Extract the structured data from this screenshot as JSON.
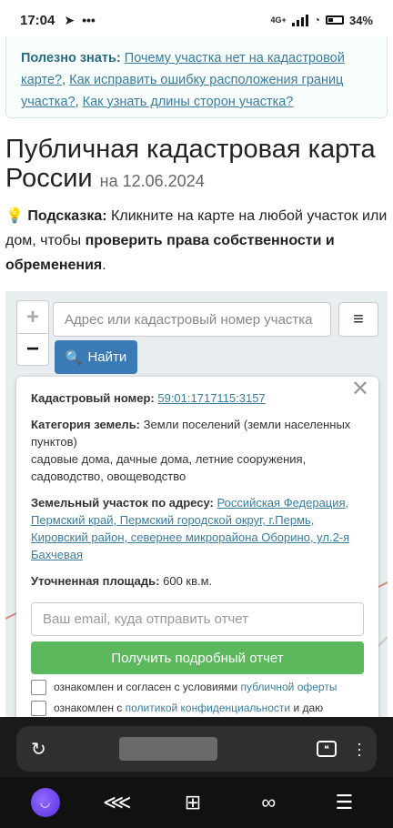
{
  "status": {
    "time": "17:04",
    "battery": "34%",
    "network": "4G+"
  },
  "info": {
    "label": "Полезно знать:",
    "link1": "Почему участка нет на кадастровой карте?",
    "link2": "Как исправить ошибку расположения границ участка?",
    "link3": "Как узнать длины сторон участка?"
  },
  "title": {
    "main": "Публичная кадастровая карта России",
    "date": "на 12.06.2024"
  },
  "hint": {
    "label": "Подсказка:",
    "text": "Кликните на карте на любой участок или дом, чтобы",
    "bold": "проверить права собственности и обременения",
    "end": "."
  },
  "map": {
    "search_placeholder": "Адрес или кадастровый номер участка",
    "find_label": "Найти",
    "zoom_in": "+",
    "zoom_out": "−",
    "menu": "≡"
  },
  "popup": {
    "cad_label": "Кадастровый номер:",
    "cad_value": "59:01:1717115:3157",
    "cat_label": "Категория земель:",
    "cat_value": "Земли поселений (земли населенных пунктов)",
    "use_value": "садовые дома, дачные дома, летние сооружения, садоводство, овощеводство",
    "addr_label": "Земельный участок по адресу:",
    "addr_value": "Российская Федерация, Пермский край, Пермский городской округ, г.Пермь, Кировский район, севернее микрорайона Оборино, ул.2-я Бахчевая",
    "area_label": "Уточненная площадь:",
    "area_value": "600 кв.м.",
    "email_placeholder": "Ваш email, куда отправить отчет",
    "report_button": "Получить подробный отчет",
    "check1_text": "ознакомлен и согласен с условиями",
    "check1_link": "публичной оферты",
    "check2_text": "ознакомлен с",
    "check2_link": "политикой конфиденциальности",
    "check2_end": "и даю"
  },
  "colors": {
    "accent": "#3a7bb5",
    "green": "#5cb85c",
    "link": "#3a7ca0"
  }
}
